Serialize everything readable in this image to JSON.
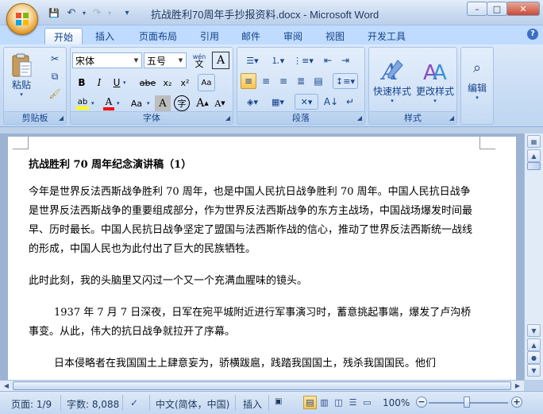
{
  "window": {
    "title": "抗战胜利70周年手抄报资料.docx - Microsoft Word",
    "minimize": "–",
    "maximize": "□",
    "close": "✕"
  },
  "qat": {
    "save": "💾",
    "undo": "↶",
    "redo": "↷",
    "customize": "▾"
  },
  "tabs": [
    "开始",
    "插入",
    "页面布局",
    "引用",
    "邮件",
    "审阅",
    "视图",
    "开发工具"
  ],
  "help": "?",
  "ribbon": {
    "clipboard": {
      "label": "剪贴板",
      "paste": "粘贴"
    },
    "font": {
      "label": "字体",
      "font_name": "宋体",
      "font_size": "五号",
      "wen": "wén",
      "wen_char": "文",
      "bold": "B",
      "italic": "I",
      "underline": "U",
      "strike": "abe",
      "subscript": "x₂",
      "superscript": "x²",
      "clear": "Aa",
      "change_case": "Aa",
      "shading_char": "A",
      "enclose_char": "字",
      "grow": "A",
      "shrink": "A"
    },
    "paragraph": {
      "label": "段落"
    },
    "styles": {
      "label": "样式",
      "quick_styles": "快速样式",
      "change_styles": "更改样式"
    },
    "editing": {
      "label": "编辑"
    }
  },
  "document": {
    "heading": "抗战胜利 70 周年纪念演讲稿（1）",
    "paragraphs": [
      "今年是世界反法西斯战争胜利 70 周年，也是中国人民抗日战争胜利 70 周年。中国人民抗日战争是世界反法西斯战争的重要组成部分，作为世界反法西斯战争的东方主战场，中国战场爆发时间最早、历时最长。中国人民抗日战争坚定了盟国与法西斯作战的信心，推动了世界反法西斯统一战线的形成，中国人民也为此付出了巨大的民族牺牲。",
      "此时此刻，我的头脑里又闪过一个又一个充满血腥味的镜头。",
      "1937 年 7 月 7 日深夜，日军在宛平城附近进行军事演习时，蓄意挑起事端，爆发了卢沟桥事变。从此，伟大的抗日战争就拉开了序幕。",
      "日本侵略者在我国国土上肆意妄为，骄横跋扈，践踏我国国土，残杀我国国民。他们"
    ]
  },
  "status": {
    "page": "页面: 1/9",
    "words": "字数: 8,088",
    "language": "中文(简体，中国)",
    "mode": "插入",
    "zoom": "100%",
    "zoom_level_percent": 100
  },
  "colors": {
    "highlight": "#ffff00",
    "font_color": "#ff0000",
    "accent": "#15428b"
  }
}
